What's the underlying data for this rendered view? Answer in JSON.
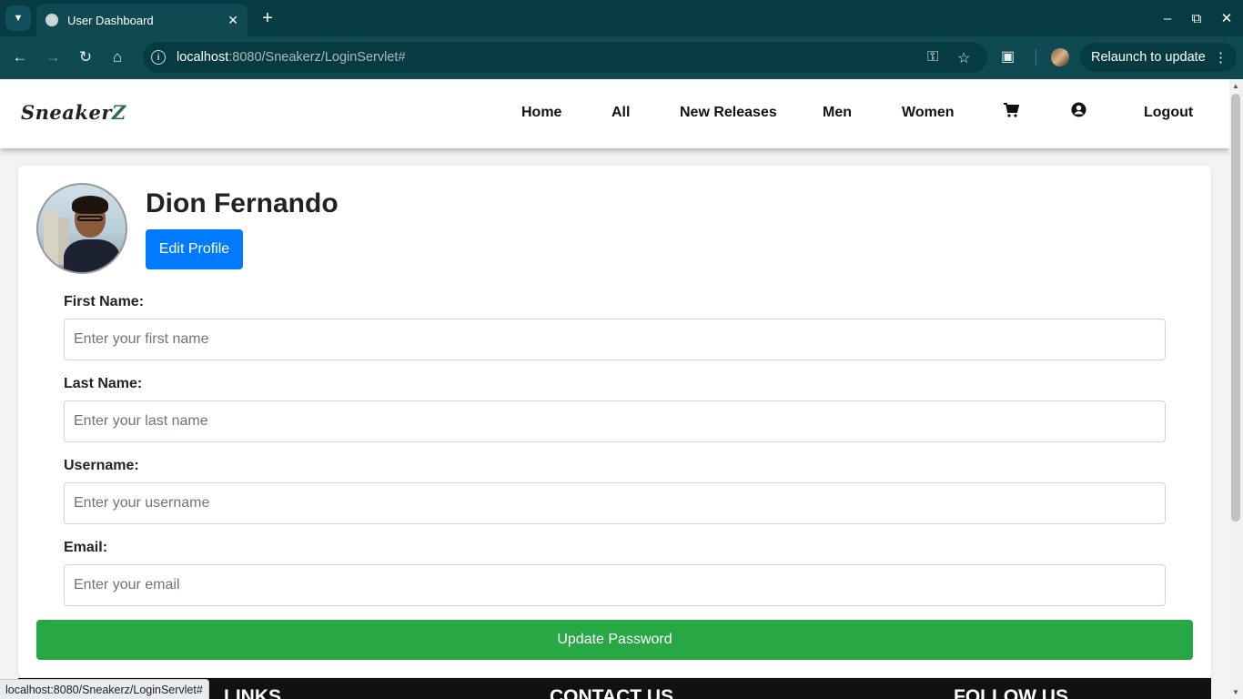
{
  "browser": {
    "tab_title": "User Dashboard",
    "url_host": "localhost",
    "url_rest": ":8080/Sneakerz/LoginServlet#",
    "relaunch_label": "Relaunch to update",
    "status_url": "localhost:8080/Sneakerz/LoginServlet#"
  },
  "site": {
    "logo_main": "Sneaker",
    "logo_accent": "Z",
    "nav": {
      "home": "Home",
      "all": "All",
      "new_releases": "New Releases",
      "men": "Men",
      "women": "Women",
      "logout": "Logout"
    }
  },
  "profile": {
    "name": "Dion Fernando",
    "edit_label": "Edit Profile"
  },
  "form": {
    "first_name_label": "First Name:",
    "first_name_placeholder": "Enter your first name",
    "last_name_label": "Last Name:",
    "last_name_placeholder": "Enter your last name",
    "username_label": "Username:",
    "username_placeholder": "Enter your username",
    "email_label": "Email:",
    "email_placeholder": "Enter your email",
    "update_label": "Update Password"
  },
  "footer": {
    "links_heading": "LINKS",
    "contact_heading": "CONTACT US",
    "follow_heading": "FOLLOW US"
  },
  "colors": {
    "chrome_dark": "#063b42",
    "chrome_toolbar": "#0f4a53",
    "primary_button": "#007bff",
    "success_button": "#28a745"
  }
}
